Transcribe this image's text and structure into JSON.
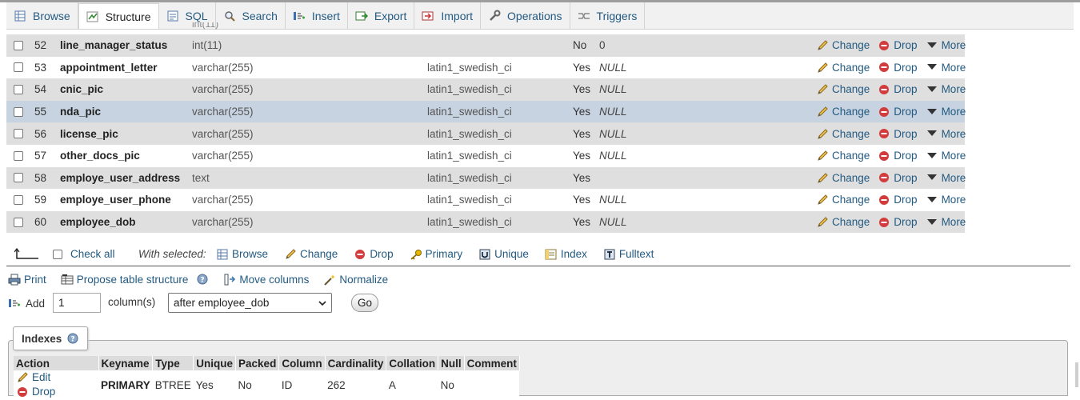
{
  "tabs": [
    {
      "label": "Browse",
      "icon": "browse-icon",
      "active": false
    },
    {
      "label": "Structure",
      "icon": "structure-icon",
      "active": true
    },
    {
      "label": "SQL",
      "icon": "sql-icon",
      "active": false
    },
    {
      "label": "Search",
      "icon": "search-icon",
      "active": false
    },
    {
      "label": "Insert",
      "icon": "insert-icon",
      "active": false
    },
    {
      "label": "Export",
      "icon": "export-icon",
      "active": false
    },
    {
      "label": "Import",
      "icon": "import-icon",
      "active": false
    },
    {
      "label": "Operations",
      "icon": "wrench-icon",
      "active": false
    },
    {
      "label": "Triggers",
      "icon": "triggers-icon",
      "active": false
    }
  ],
  "fields_top_partial": "int(11)",
  "fields": [
    {
      "num": "52",
      "name": "line_manager_status",
      "type": "int(11)",
      "collation": "",
      "null": "No",
      "default": "0"
    },
    {
      "num": "53",
      "name": "appointment_letter",
      "type": "varchar(255)",
      "collation": "latin1_swedish_ci",
      "null": "Yes",
      "default": "NULL"
    },
    {
      "num": "54",
      "name": "cnic_pic",
      "type": "varchar(255)",
      "collation": "latin1_swedish_ci",
      "null": "Yes",
      "default": "NULL"
    },
    {
      "num": "55",
      "name": "nda_pic",
      "type": "varchar(255)",
      "collation": "latin1_swedish_ci",
      "null": "Yes",
      "default": "NULL"
    },
    {
      "num": "56",
      "name": "license_pic",
      "type": "varchar(255)",
      "collation": "latin1_swedish_ci",
      "null": "Yes",
      "default": "NULL"
    },
    {
      "num": "57",
      "name": "other_docs_pic",
      "type": "varchar(255)",
      "collation": "latin1_swedish_ci",
      "null": "Yes",
      "default": "NULL"
    },
    {
      "num": "58",
      "name": "employe_user_address",
      "type": "text",
      "collation": "latin1_swedish_ci",
      "null": "Yes",
      "default": ""
    },
    {
      "num": "59",
      "name": "employe_user_phone",
      "type": "varchar(255)",
      "collation": "latin1_swedish_ci",
      "null": "Yes",
      "default": "NULL"
    },
    {
      "num": "60",
      "name": "employee_dob",
      "type": "varchar(255)",
      "collation": "latin1_swedish_ci",
      "null": "Yes",
      "default": "NULL"
    }
  ],
  "row_actions": {
    "change": "Change",
    "drop": "Drop",
    "more": "More"
  },
  "with_selected": {
    "check_all": "Check all",
    "label": "With selected:",
    "actions": [
      {
        "label": "Browse",
        "icon": "browse-icon"
      },
      {
        "label": "Change",
        "icon": "pencil-icon"
      },
      {
        "label": "Drop",
        "icon": "drop-icon"
      },
      {
        "label": "Primary",
        "icon": "key-icon"
      },
      {
        "label": "Unique",
        "icon": "unique-icon"
      },
      {
        "label": "Index",
        "icon": "index-icon"
      },
      {
        "label": "Fulltext",
        "icon": "fulltext-icon"
      }
    ]
  },
  "links": [
    {
      "label": "Print",
      "icon": "print-icon"
    },
    {
      "label": "Propose table structure",
      "icon": "propose-icon"
    },
    {
      "label": "Move columns",
      "icon": "move-columns-icon"
    },
    {
      "label": "Normalize",
      "icon": "wand-icon"
    }
  ],
  "add_columns": {
    "label": "Add",
    "count": "1",
    "unit": "column(s)",
    "position": "after employee_dob",
    "go": "Go"
  },
  "indexes": {
    "title": "Indexes",
    "headers": [
      "Action",
      "Keyname",
      "Type",
      "Unique",
      "Packed",
      "Column",
      "Cardinality",
      "Collation",
      "Null",
      "Comment"
    ],
    "rows": [
      {
        "edit": "Edit",
        "drop": "Drop",
        "keyname": "PRIMARY",
        "type": "BTREE",
        "unique": "Yes",
        "packed": "No",
        "column": "ID",
        "cardinality": "262",
        "collation": "A",
        "null": "No",
        "comment": ""
      }
    ]
  },
  "colors": {
    "link": "#235a81",
    "row_alt": "#dfdfdf",
    "row_highlight": "#c7d3e0",
    "drop_red": "#d33c3c"
  }
}
